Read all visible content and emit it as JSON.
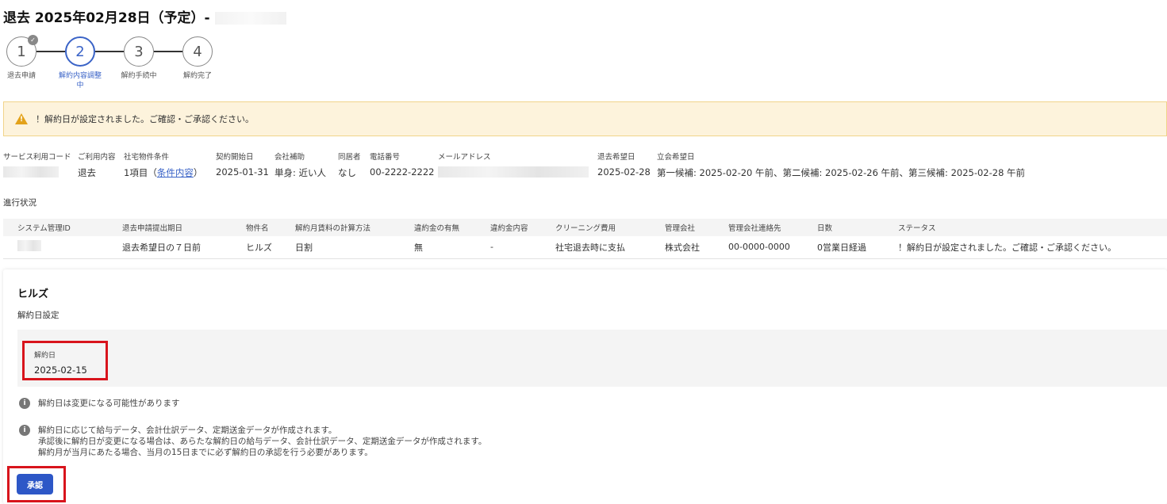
{
  "header": {
    "title": "退去 2025年02月28日（予定）-"
  },
  "stepper": {
    "steps": [
      {
        "num": "1",
        "label": "退去申請"
      },
      {
        "num": "2",
        "label": "解約内容調整中"
      },
      {
        "num": "3",
        "label": "解約手続中"
      },
      {
        "num": "4",
        "label": "解約完了"
      }
    ],
    "check_glyph": "✓"
  },
  "alert": {
    "icon": "warning-icon",
    "text": "！解約日が設定されました。ご確認・ご承認ください。"
  },
  "info": {
    "service_code_label": "サービス利用コード",
    "usage_label": "ご利用内容",
    "usage_value": "退去",
    "property_cond_label": "社宅物件条件",
    "property_cond_prefix": "1項目（",
    "property_cond_link": "条件内容",
    "property_cond_suffix": "）",
    "contract_start_label": "契約開始日",
    "contract_start_value": "2025-01-31",
    "subsidy_label": "会社補助",
    "subsidy_value": "単身: 近い人",
    "cohabitant_label": "同居者",
    "cohabitant_value": "なし",
    "phone_label": "電話番号",
    "phone_value": "00-2222-2222",
    "email_label": "メールアドレス",
    "move_out_label": "退去希望日",
    "move_out_value": "2025-02-28",
    "attendance_label": "立会希望日",
    "attendance_value": "第一候補: 2025-02-20 午前、第二候補: 2025-02-26 午前、第三候補: 2025-02-28 午前"
  },
  "progress": {
    "label": "進行状況",
    "headers": [
      "システム管理ID",
      "退去申請提出期日",
      "物件名",
      "解約月賃料の計算方法",
      "違約金の有無",
      "違約金内容",
      "クリーニング費用",
      "管理会社",
      "管理会社連絡先",
      "日数",
      "ステータス"
    ],
    "row": [
      "",
      "退去希望日の７日前",
      "ヒルズ",
      "日割",
      "無",
      "-",
      "社宅退去時に支払",
      "株式会社",
      "00-0000-0000",
      "0営業日経過",
      "！解約日が設定されました。ご確認・ご承認ください。"
    ]
  },
  "detail": {
    "property_name": "ヒルズ",
    "section_title": "解約日設定",
    "cancel_date_label": "解約日",
    "cancel_date_value": "2025-02-15",
    "note1": "解約日は変更になる可能性があります",
    "note2_line1": "解約日に応じて給与データ、会計仕訳データ、定期送金データが作成されます。",
    "note2_line2": "承認後に解約日が変更になる場合は、あらたな解約日の給与データ、会計仕訳データ、定期送金データが作成されます。",
    "note2_line3": "解約月が当月にあたる場合、当月の15日までに必ず解約日の承認を行う必要があります。",
    "info_glyph": "i",
    "approve_label": "承認"
  },
  "colors": {
    "accent": "#2d57c7",
    "highlight_border": "#d8141c",
    "alert_bg": "#fdf3dc"
  }
}
